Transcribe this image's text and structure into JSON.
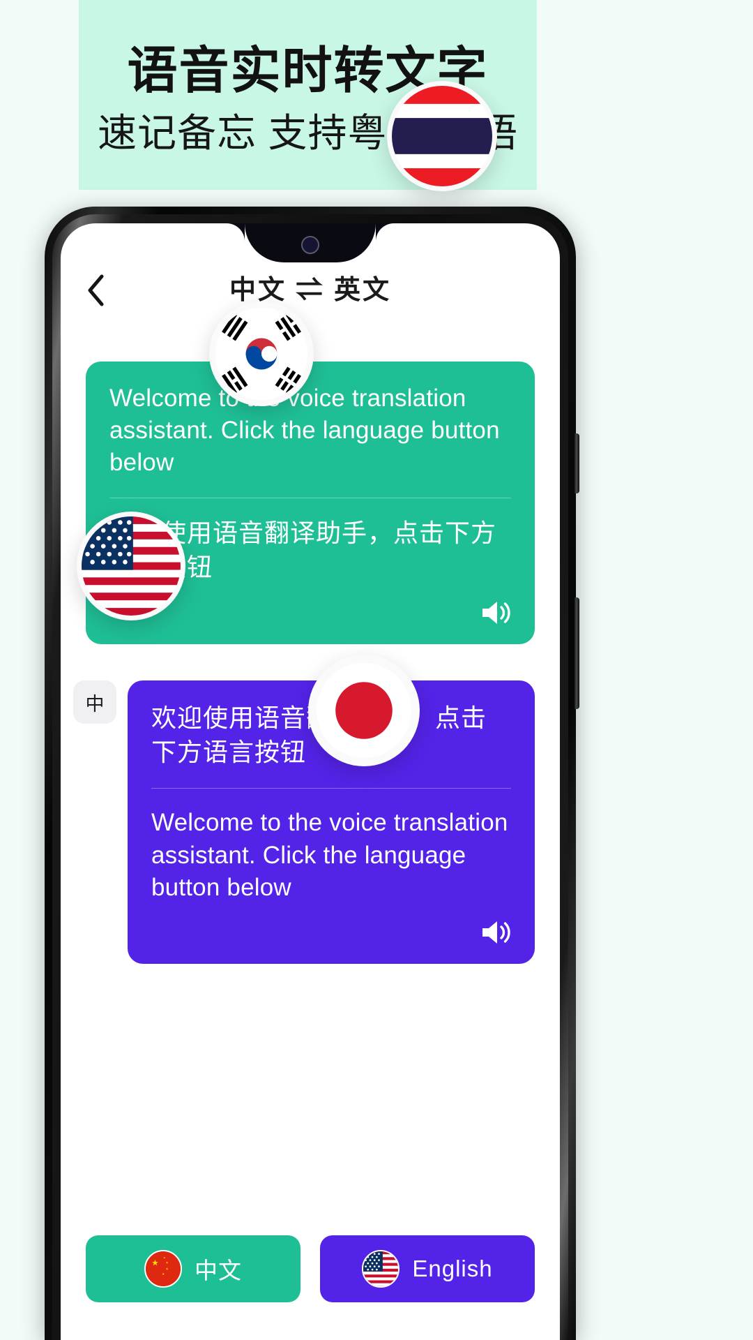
{
  "promo": {
    "title": "语音实时转文字",
    "subtitle": "速记备忘 支持粤语 英语",
    "band_color": "#c9f7e5"
  },
  "navbar": {
    "back_icon": "back-chevron-icon",
    "source_language": "中文",
    "swap_icon": "⇌",
    "target_language": "英文",
    "title_full": "中文 ⇌ 英文"
  },
  "messages": [
    {
      "side": "right",
      "bubble_color": "#1fbf96",
      "primary_text": "Welcome to the voice translation assistant. Click the language button below",
      "translated_text": "欢迎使用语音翻译助手，点击下方语言按钮",
      "speaker_icon": "speaker-icon"
    },
    {
      "side": "left",
      "avatar_label": "中",
      "bubble_color": "#5423e8",
      "primary_text": "欢迎使用语音翻译助手，点击下方语言按钮",
      "translated_text": "Welcome to the voice translation assistant. Click the language button below",
      "speaker_icon": "speaker-icon"
    }
  ],
  "language_buttons": [
    {
      "label": "中文",
      "flag": "china-flag-icon",
      "color": "#1fbf96"
    },
    {
      "label": "English",
      "flag": "usa-flag-icon",
      "color": "#5423e8"
    }
  ],
  "floating_flags": [
    {
      "name": "thailand-flag-icon"
    },
    {
      "name": "south-korea-flag-icon"
    },
    {
      "name": "usa-flag-icon"
    },
    {
      "name": "japan-flag-icon"
    }
  ]
}
